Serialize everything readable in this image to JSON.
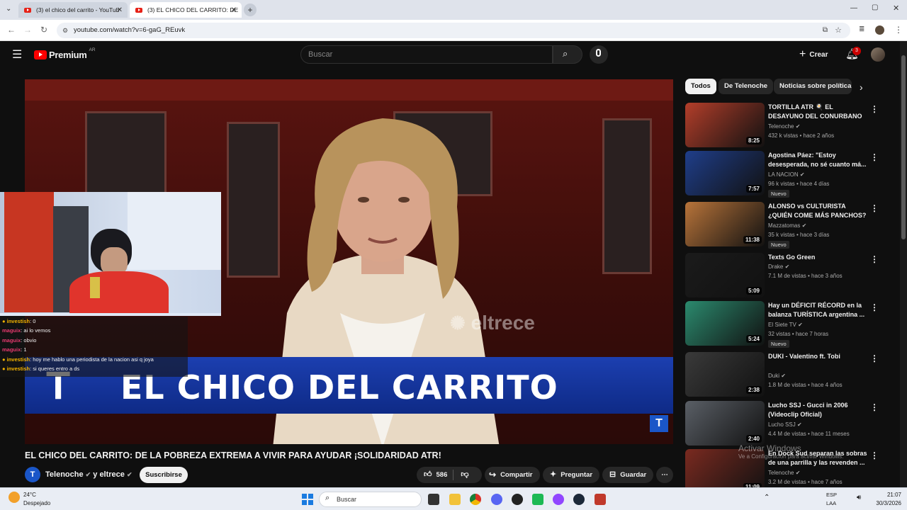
{
  "browser": {
    "tabs": [
      {
        "title": "(3) el chico del carrito - YouTub"
      },
      {
        "title": "(3) EL CHICO DEL CARRITO: DE"
      }
    ],
    "url": "youtube.com/watch?v=6-gaG_REuvk"
  },
  "header": {
    "logo": "Premium",
    "region": "AR",
    "search_placeholder": "Buscar",
    "create_label": "Crear",
    "notif_count": "3"
  },
  "video": {
    "banner": "EL CHICO DEL CARRITO",
    "watermark": "eltrece",
    "title": "EL CHICO DEL CARRITO: DE LA POBREZA EXTREMA A VIVIR PARA AYUDAR ¡SOLIDARIDAD ATR!",
    "channel": "Telenoche",
    "coauthor": "y eltrece",
    "subscribe": "Suscribirse",
    "likes": "586",
    "share": "Compartir",
    "ask": "Preguntar",
    "save": "Guardar"
  },
  "chat": [
    {
      "user": "investish",
      "msg": ": 0",
      "color": "#f5b400"
    },
    {
      "user": "maguix",
      "msg": ": ai lo vemos",
      "color": "#e83a6f"
    },
    {
      "user": "maguix",
      "msg": ": obvio",
      "color": "#e83a6f"
    },
    {
      "user": "maguix",
      "msg": ": 1",
      "color": "#e83a6f"
    },
    {
      "user": "investish",
      "msg": ": hoy me hablo una periodista de la nacion asi q joya",
      "color": "#f5b400"
    },
    {
      "user": "investish",
      "msg": ": si queres entro a ds",
      "color": "#f5b400"
    }
  ],
  "chips": [
    "Todos",
    "De Telenoche",
    "Noticias sobre política"
  ],
  "recommendations": [
    {
      "title": "TORTILLA ATR 🍳 EL DESAYUNO DEL CONURBANO ...",
      "channel": "Telenoche",
      "meta": "432 k vistas • hace 2 años",
      "duration": "8:25",
      "new": "",
      "color": "#b33e2a"
    },
    {
      "title": "Agostina Páez: \"Estoy desesperada, no sé cuanto má...",
      "channel": "LA NACION",
      "meta": "96 k vistas • hace 4 días",
      "duration": "7:57",
      "new": "Nuevo",
      "color": "#1f3e8a"
    },
    {
      "title": "ALONSO vs CULTURISTA ¿QUIÉN COME MÁS PANCHOS?",
      "channel": "Mazzatomas",
      "meta": "35 k vistas • hace 3 días",
      "duration": "11:38",
      "new": "Nuevo",
      "color": "#b8743a"
    },
    {
      "title": "Texts Go Green",
      "channel": "Drake",
      "meta": "7.1 M de vistas • hace 3 años",
      "duration": "5:09",
      "new": "",
      "color": "#1b1b1b"
    },
    {
      "title": "Hay un DÉFICIT RÉCORD en la balanza TURÍSTICA argentina ...",
      "channel": "El Siete TV",
      "meta": "32 vistas • hace 7 horas",
      "duration": "5:24",
      "new": "Nuevo",
      "color": "#2b8a6e"
    },
    {
      "title": "DUKI - Valentino ft. Tobi",
      "channel": "Duki",
      "meta": "1.8 M de vistas • hace 4 años",
      "duration": "2:38",
      "new": "",
      "color": "#3a3a3a"
    },
    {
      "title": "Lucho SSJ - Gucci in 2006 (Videoclip Oficial)",
      "channel": "Lucho SSJ",
      "meta": "4.4 M de vistas • hace 11 meses",
      "duration": "2:40",
      "new": "",
      "color": "#5a5f66"
    },
    {
      "title": "En Dock Sud separan las sobras de una parrilla y las revenden ...",
      "channel": "Telenoche",
      "meta": "3.2 M de vistas • hace 7 años",
      "duration": "11:09",
      "new": "",
      "color": "#7a2a20"
    }
  ],
  "windows_watermark": {
    "line1": "Activar Windows",
    "line2": "Ve a Configuración para activar Windows."
  },
  "taskbar": {
    "temp": "24°C",
    "weather": "Despejado",
    "search": "Buscar",
    "lang1": "ESP",
    "lang2": "LAA",
    "time": "21:07",
    "date": "30/3/2026"
  }
}
